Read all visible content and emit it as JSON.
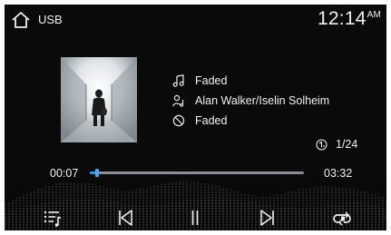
{
  "header": {
    "source": "USB",
    "time": "12:14",
    "ampm": "AM"
  },
  "track": {
    "song": "Faded",
    "artist": "Alan Walker/Iselin Solheim",
    "album": "Faded",
    "counter": "1/24"
  },
  "playback": {
    "elapsed": "00:07",
    "total": "03:32",
    "progress_fraction": 0.033
  },
  "icons": {
    "home": "home-icon",
    "song": "music-note-icon",
    "artist": "artist-icon",
    "album": "album-disc-icon",
    "counter": "track-number-icon",
    "list": "playlist-icon",
    "prev": "previous-track-icon",
    "pause": "pause-icon",
    "next": "next-track-icon",
    "repeat": "repeat-icon"
  },
  "colors": {
    "background": "#0a0a0a",
    "progress_accent": "#3d8fe0",
    "progress_track": "#8a8f95",
    "text": "#f0f0f0"
  }
}
